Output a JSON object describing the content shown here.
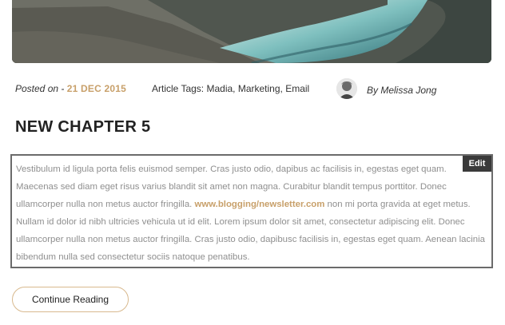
{
  "post": {
    "posted_prefix": "Posted on - ",
    "date": "21 DEC 2015",
    "tags_prefix": "Article Tags: ",
    "tags": "Madia, Marketing, Email",
    "author": "By Melissa Jong",
    "title": "NEW CHAPTER 5",
    "edit_label": "Edit",
    "body_before": "Vestibulum id ligula porta felis euismod semper. Cras justo odio, dapibus ac facilisis in, egestas eget quam. Maecenas sed diam eget risus varius blandit sit amet non magna. Curabitur blandit tempus porttitor. Donec ullamcorper nulla non metus auctor fringilla. ",
    "body_link": "www.blogging/newsletter.com",
    "body_after": " non mi porta gravida at eget metus. Nullam id dolor id nibh ultricies vehicula ut id elit. Lorem ipsum dolor sit amet, consectetur adipiscing elit. Donec ullamcorper nulla non metus auctor fringilla. Cras justo odio, dapibusc facilisis in, egestas eget quam. Aenean lacinia bibendum nulla sed consectetur sociis natoque penatibus.",
    "cta_label": "Continue Reading"
  },
  "colors": {
    "accent": "#c8a06a",
    "body_text": "#8f8f8f",
    "edit_bg": "#3a3a3a"
  }
}
